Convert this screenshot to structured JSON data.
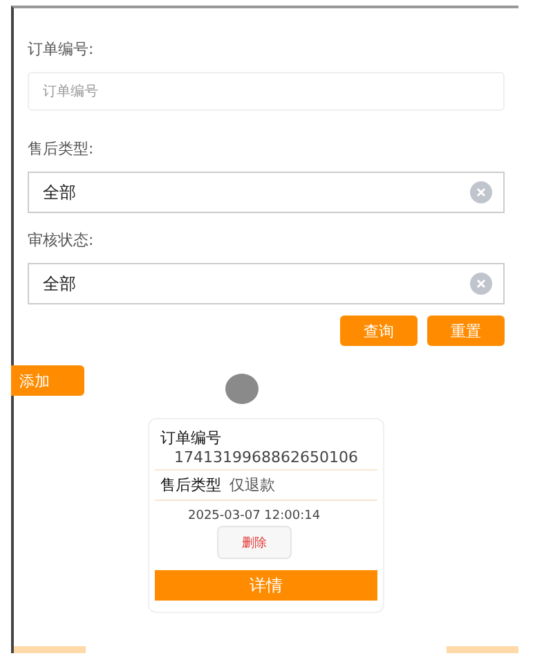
{
  "filters": [
    {
      "label": "订单编号:",
      "kind": "input",
      "placeholder": "订单编号"
    },
    {
      "label": "售后类型:",
      "kind": "select",
      "value": "全部"
    },
    {
      "label": "审核状态:",
      "kind": "select",
      "value": "全部"
    }
  ],
  "actions": [
    "查询",
    "重置"
  ],
  "add_button": "添加",
  "orders": [
    {
      "order_no_label": "订单编号",
      "order_no": "1741319968862650106",
      "type_label": "售后类型",
      "type": "仅退款",
      "time": "2025-03-07 12:00:14",
      "delete": "删除",
      "detail": "详情"
    }
  ]
}
